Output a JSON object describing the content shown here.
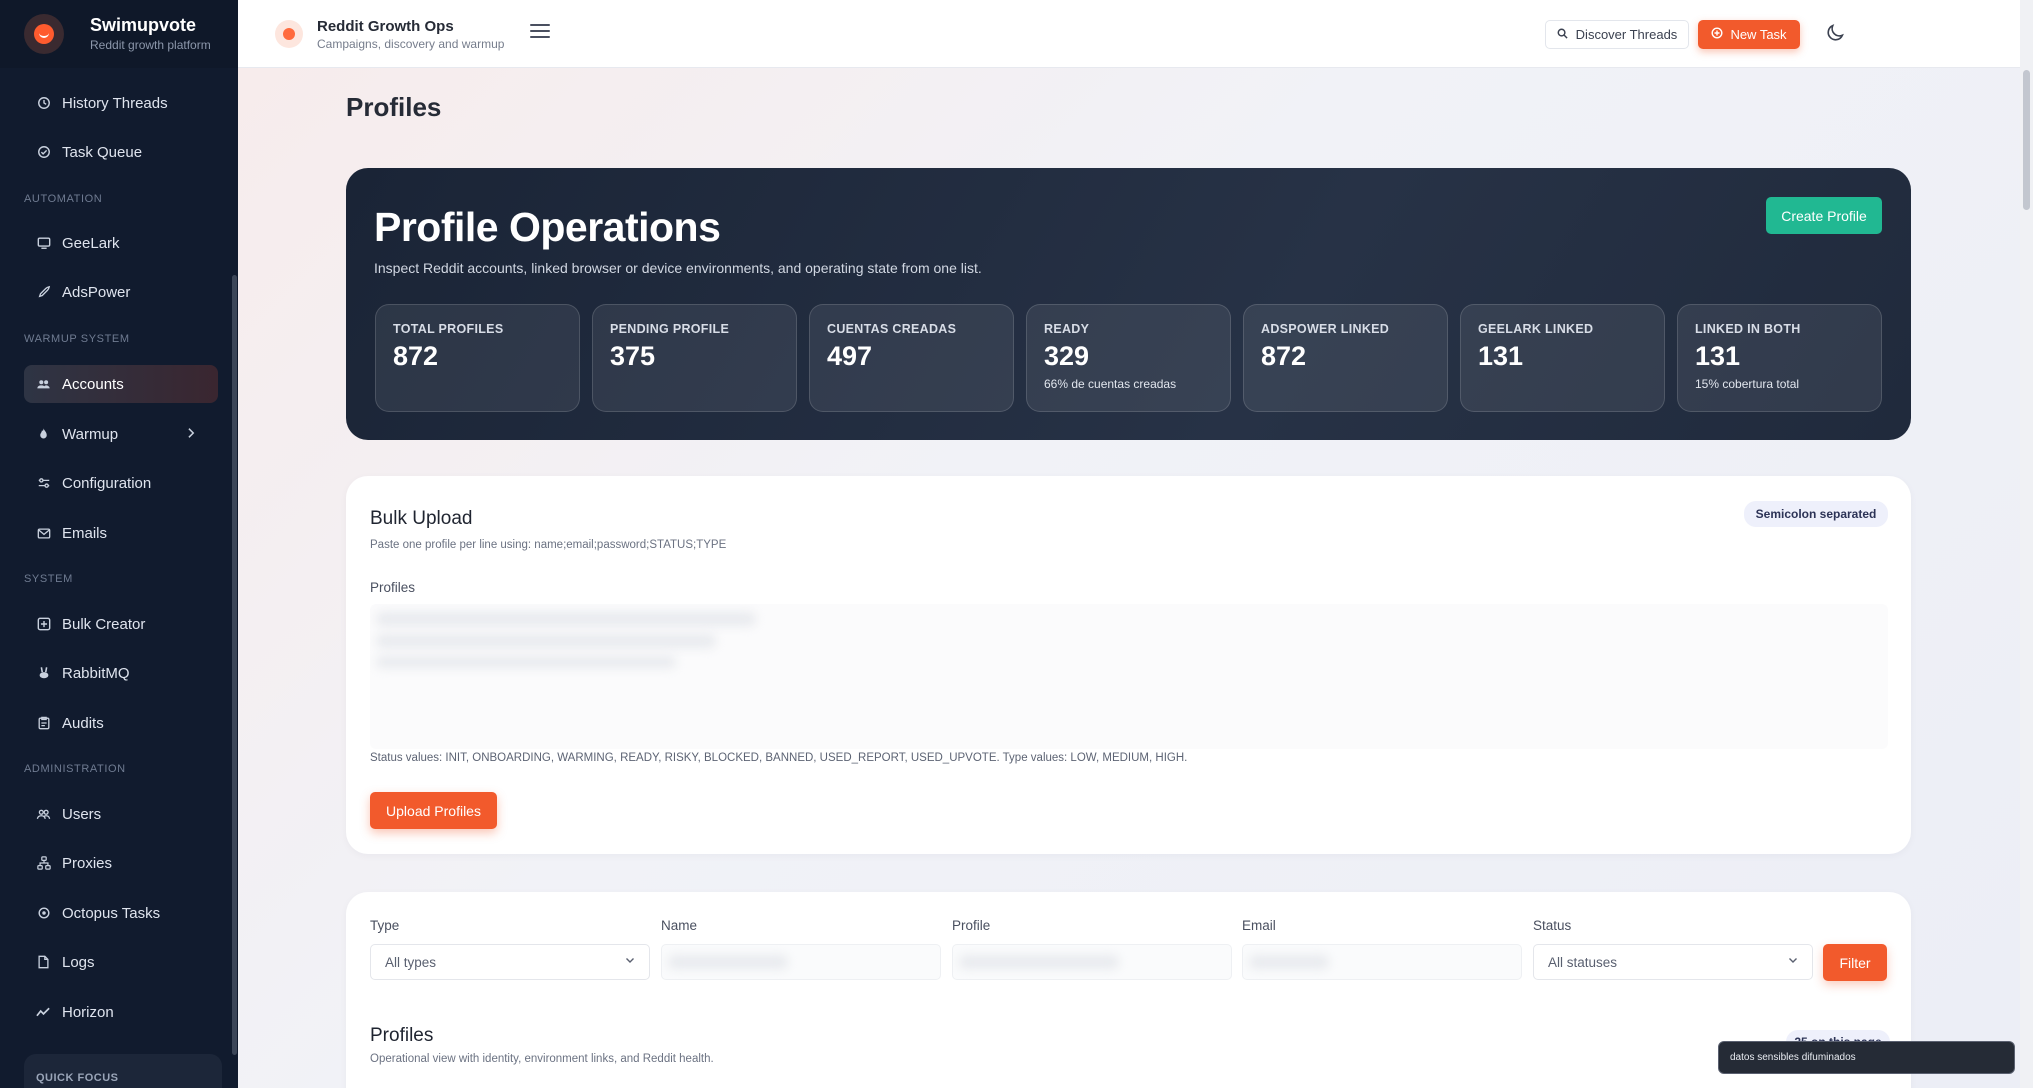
{
  "brand": {
    "name": "Swimupvote",
    "subtitle": "Reddit growth platform"
  },
  "sidebar": {
    "items": [
      {
        "label": "History Threads",
        "icon": "history-icon"
      },
      {
        "label": "Task Queue",
        "icon": "check-circle-icon"
      },
      {
        "label": "GeeLark",
        "icon": "device-icon"
      },
      {
        "label": "AdsPower",
        "icon": "rocket-icon"
      },
      {
        "label": "Accounts",
        "icon": "users-icon"
      },
      {
        "label": "Warmup",
        "icon": "flame-icon"
      },
      {
        "label": "Configuration",
        "icon": "sliders-icon"
      },
      {
        "label": "Emails",
        "icon": "mail-icon"
      },
      {
        "label": "Bulk Creator",
        "icon": "plus-square-icon"
      },
      {
        "label": "RabbitMQ",
        "icon": "rabbit-icon"
      },
      {
        "label": "Audits",
        "icon": "clipboard-icon"
      },
      {
        "label": "Users",
        "icon": "users-icon"
      },
      {
        "label": "Proxies",
        "icon": "network-icon"
      },
      {
        "label": "Octopus Tasks",
        "icon": "gear-icon"
      },
      {
        "label": "Logs",
        "icon": "file-icon"
      },
      {
        "label": "Horizon",
        "icon": "activity-icon"
      }
    ],
    "sections": {
      "automation": "Automation",
      "warmup_system": "Warmup System",
      "system": "System",
      "administration": "Administration"
    },
    "active_item": "Accounts",
    "quick_focus": "QUICK FOCUS"
  },
  "topbar": {
    "title": "Reddit Growth Ops",
    "subtitle": "Campaigns, discovery and warmup",
    "discover_label": "Discover Threads",
    "new_task_label": "New Task"
  },
  "page": {
    "title": "Profiles"
  },
  "hero": {
    "title": "Profile Operations",
    "subtitle": "Inspect Reddit accounts, linked browser or device environments, and operating state from one list.",
    "create_label": "Create Profile",
    "stats": [
      {
        "label": "Total Profiles",
        "value": "872",
        "note": ""
      },
      {
        "label": "Pending Profile",
        "value": "375",
        "note": ""
      },
      {
        "label": "Cuentas Creadas",
        "value": "497",
        "note": ""
      },
      {
        "label": "Ready",
        "value": "329",
        "note": "66% de cuentas creadas"
      },
      {
        "label": "AdsPower Linked",
        "value": "872",
        "note": ""
      },
      {
        "label": "GeeLark Linked",
        "value": "131",
        "note": ""
      },
      {
        "label": "Linked in Both",
        "value": "131",
        "note": "15% cobertura total"
      }
    ]
  },
  "bulk": {
    "title": "Bulk Upload",
    "subtitle": "Paste one profile per line using: name;email;password;STATUS;TYPE",
    "badge": "Semicolon separated",
    "field_label": "Profiles",
    "status_values": "Status values: INIT, ONBOARDING, WARMING, READY, RISKY, BLOCKED, BANNED, USED_REPORT, USED_UPVOTE. Type values: LOW, MEDIUM, HIGH.",
    "upload_label": "Upload Profiles"
  },
  "filters": {
    "type_label": "Type",
    "type_value": "All types",
    "name_label": "Name",
    "profile_label": "Profile",
    "email_label": "Email",
    "status_label": "Status",
    "status_value": "All statuses",
    "filter_label": "Filter"
  },
  "profiles": {
    "title": "Profiles",
    "subtitle": "Operational view with identity, environment links, and Reddit health.",
    "page_badge": "25 on this page"
  },
  "toast": {
    "text": "datos sensibles difuminados"
  }
}
